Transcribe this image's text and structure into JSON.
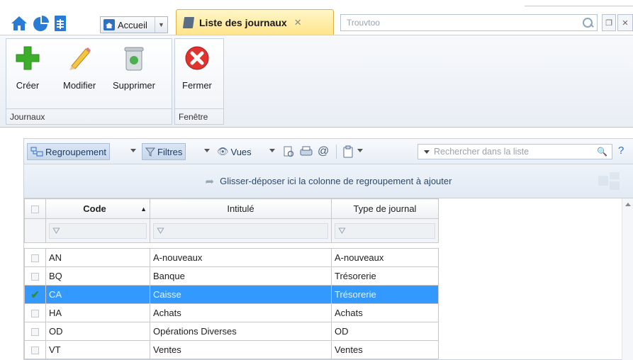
{
  "header": {
    "home_tab_label": "Accueil",
    "active_tab_label": "Liste des journaux",
    "search_placeholder": "Trouvtoo"
  },
  "ribbon": {
    "groups": [
      {
        "label": "Journaux",
        "buttons": [
          {
            "label": "Créer",
            "icon": "plus-icon"
          },
          {
            "label": "Modifier",
            "icon": "pencil-icon"
          },
          {
            "label": "Supprimer",
            "icon": "trash-icon"
          }
        ]
      },
      {
        "label": "Fenêtre",
        "buttons": [
          {
            "label": "Fermer",
            "icon": "close-icon"
          }
        ]
      }
    ]
  },
  "toolbar": {
    "regroupement_label": "Regroupement",
    "filtres_label": "Filtres",
    "vues_label": "Vues",
    "search_placeholder": "Rechercher dans la liste",
    "help_label": "?"
  },
  "groupbar": {
    "hint": "Glisser-déposer ici la colonne de regroupement à ajouter"
  },
  "grid": {
    "columns": [
      "Code",
      "Intitulé",
      "Type de journal"
    ],
    "rows": [
      {
        "code": "AN",
        "intitule": "A-nouveaux",
        "type": "A-nouveaux",
        "selected": false
      },
      {
        "code": "BQ",
        "intitule": "Banque",
        "type": "Trésorerie",
        "selected": false
      },
      {
        "code": "CA",
        "intitule": "Caisse",
        "type": "Trésorerie",
        "selected": true
      },
      {
        "code": "HA",
        "intitule": "Achats",
        "type": "Achats",
        "selected": false
      },
      {
        "code": "OD",
        "intitule": "Opérations Diverses",
        "type": "OD",
        "selected": false
      },
      {
        "code": "VT",
        "intitule": "Ventes",
        "type": "Ventes",
        "selected": false
      }
    ]
  },
  "colors": {
    "selection": "#3399ff",
    "active_tab": "#ffe48a",
    "accent_blue": "#2f6fc4"
  }
}
